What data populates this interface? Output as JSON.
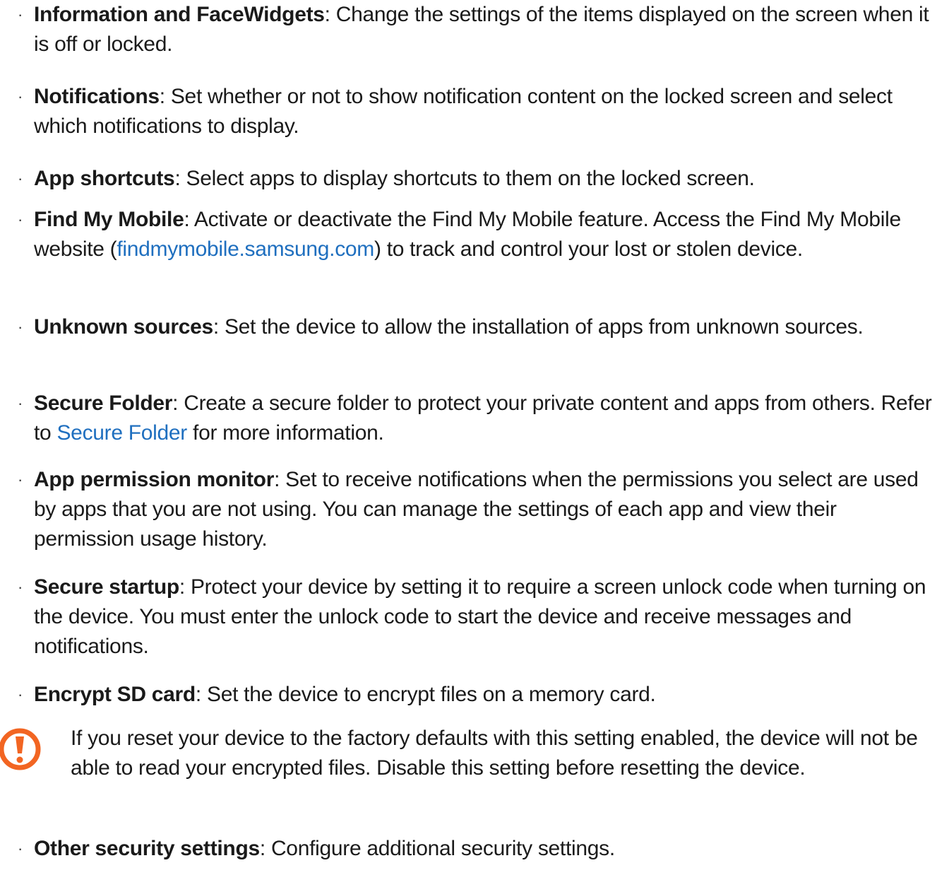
{
  "items": [
    {
      "title": "Information and FaceWidgets",
      "text": ": Change the settings of the items displayed on the screen when it is off or locked."
    },
    {
      "title": "Notifications",
      "text": ": Set whether or not to show notification content on the locked screen and select which notifications to display."
    },
    {
      "title": "App shortcuts",
      "text": ": Select apps to display shortcuts to them on the locked screen."
    },
    {
      "title": "Find My Mobile",
      "text_before": ": Activate or deactivate the Find My Mobile feature. Access the Find My Mobile website (",
      "link": "findmymobile.samsung.com",
      "text_after": ") to track and control your lost or stolen device."
    },
    {
      "title": "Unknown sources",
      "text": ": Set the device to allow the installation of apps from unknown sources."
    },
    {
      "title": "Secure Folder",
      "text_before": ": Create a secure folder to protect your private content and apps from others. Refer to ",
      "link": "Secure Folder",
      "text_after": " for more information."
    },
    {
      "title": "App permission monitor",
      "text": ": Set to receive notifications when the permissions you select are used by apps that you are not using. You can manage the settings of each app and view their permission usage history."
    },
    {
      "title": "Secure startup",
      "text": ": Protect your device by setting it to require a screen unlock code when turning on the device. You must enter the unlock code to start the device and receive messages and notifications."
    },
    {
      "title": "Encrypt SD card",
      "text": ": Set the device to encrypt files on a memory card."
    },
    {
      "title": "Other security settings",
      "text": ": Configure additional security settings."
    }
  ],
  "bullet_symbol": "·",
  "warning": {
    "icon": "caution-exclamation-icon",
    "text": "If you reset your device to the factory defaults with this setting enabled, the device will not be able to read your encrypted files. Disable this setting before resetting the device.",
    "color": "#f26522"
  },
  "colors": {
    "link": "#1f6fbf",
    "text": "#1a1a1a"
  }
}
